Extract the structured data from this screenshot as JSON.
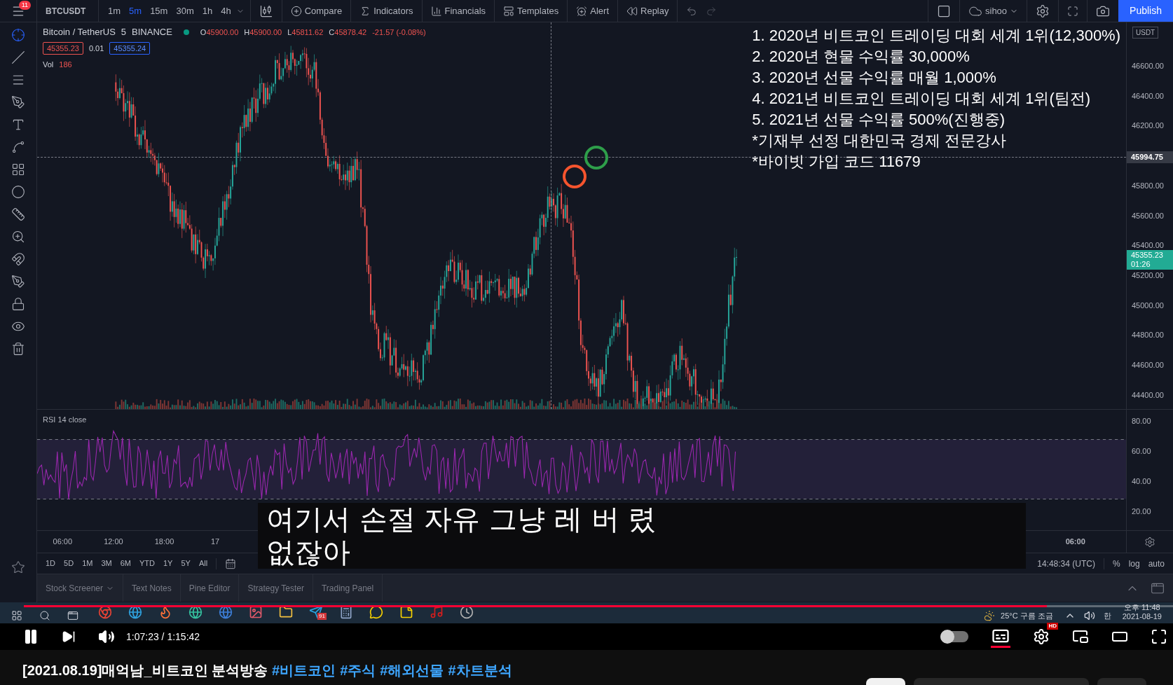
{
  "tradingview": {
    "top_toolbar": {
      "notification_count": "11",
      "symbol": "BTCUSDT",
      "intervals": [
        {
          "label": "1m",
          "selected": false
        },
        {
          "label": "5m",
          "selected": true
        },
        {
          "label": "15m",
          "selected": false
        },
        {
          "label": "30m",
          "selected": false
        },
        {
          "label": "1h",
          "selected": false
        },
        {
          "label": "4h",
          "selected": false
        }
      ],
      "buttons": [
        {
          "kind": "compare",
          "label": "Compare"
        },
        {
          "kind": "indicators",
          "label": "Indicators"
        },
        {
          "kind": "financials",
          "label": "Financials"
        },
        {
          "kind": "templates",
          "label": "Templates"
        },
        {
          "kind": "alert",
          "label": "Alert"
        },
        {
          "kind": "replay",
          "label": "Replay"
        }
      ],
      "layout_name": "sihoo",
      "publish": "Publish"
    },
    "legend": {
      "symbol_name": "Bitcoin / TetherUS",
      "interval": "5",
      "exchange": "BINANCE",
      "ohlc": [
        {
          "label": "O",
          "value": "45900.00"
        },
        {
          "label": "H",
          "value": "45900.00"
        },
        {
          "label": "L",
          "value": "45811.62"
        },
        {
          "label": "C",
          "value": "45878.42"
        }
      ],
      "change": "-21.57 (-0.08%)",
      "sell_price": "45355.23",
      "spread": "0.01",
      "buy_price": "45355.24",
      "volume_label": "Vol",
      "volume_value": "186"
    },
    "overlay_notes": [
      "1. 2020년 비트코인 트레이딩 대회 세계 1위(12,300%)",
      "2. 2020년 현물 수익률 30,000%",
      "3. 2020년 선물 수익률 매월 1,000%",
      "4. 2021년 비트코인 트레이딩 대회 세계 1위(팀전)",
      "5. 2021년 선물 수익률 500%(진행중)",
      "*기재부 선정 대한민국 경제 전문강사",
      "*바이빗 가입 코드 11679"
    ],
    "price_axis": {
      "currency": "USDT",
      "labels": [
        "46600.00",
        "46400.00",
        "46200.00",
        "45800.00",
        "45600.00",
        "45400.00",
        "45200.00",
        "45000.00",
        "44800.00",
        "44600.00",
        "44400.00"
      ],
      "crosshair_price": "45994.75",
      "last_price": "45355.23",
      "countdown": "01:26"
    },
    "rsi": {
      "label": "RSI 14 close",
      "axis_labels": [
        "80.00",
        "60.00",
        "40.00",
        "20.00"
      ]
    },
    "time_axis_left": [
      "06:00",
      "12:00",
      "18:00",
      "17"
    ],
    "time_axis_right": [
      "06:00"
    ],
    "range_buttons": [
      "1D",
      "5D",
      "1M",
      "3M",
      "6M",
      "YTD",
      "1Y",
      "5Y",
      "All"
    ],
    "clock": "14:48:34 (UTC)",
    "scale_buttons": [
      "%",
      "log",
      "auto"
    ],
    "bottom_tabs": [
      "Stock Screener",
      "Text Notes",
      "Pine Editor",
      "Strategy Tester",
      "Trading Panel"
    ]
  },
  "taskbar": {
    "badge": "91",
    "weather": "25°C 구름 조금",
    "ime": "한",
    "time": "오후 11:48",
    "date": "2021-08-19"
  },
  "subtitle": [
    "여기서 손절 자유 그냥 레 버 렸",
    "없잖아"
  ],
  "player": {
    "progress": {
      "level": 0.89
    },
    "time": "1:07:23 / 1:15:42",
    "autoplay_on": false,
    "captions_on": true,
    "quality_badge": "HD"
  },
  "video_title": {
    "text": "[2021.08.19]매억남_비트코인 분석방송",
    "hashtags": [
      "#비트코인",
      "#주식",
      "#해외선물",
      "#차트분석"
    ]
  }
}
